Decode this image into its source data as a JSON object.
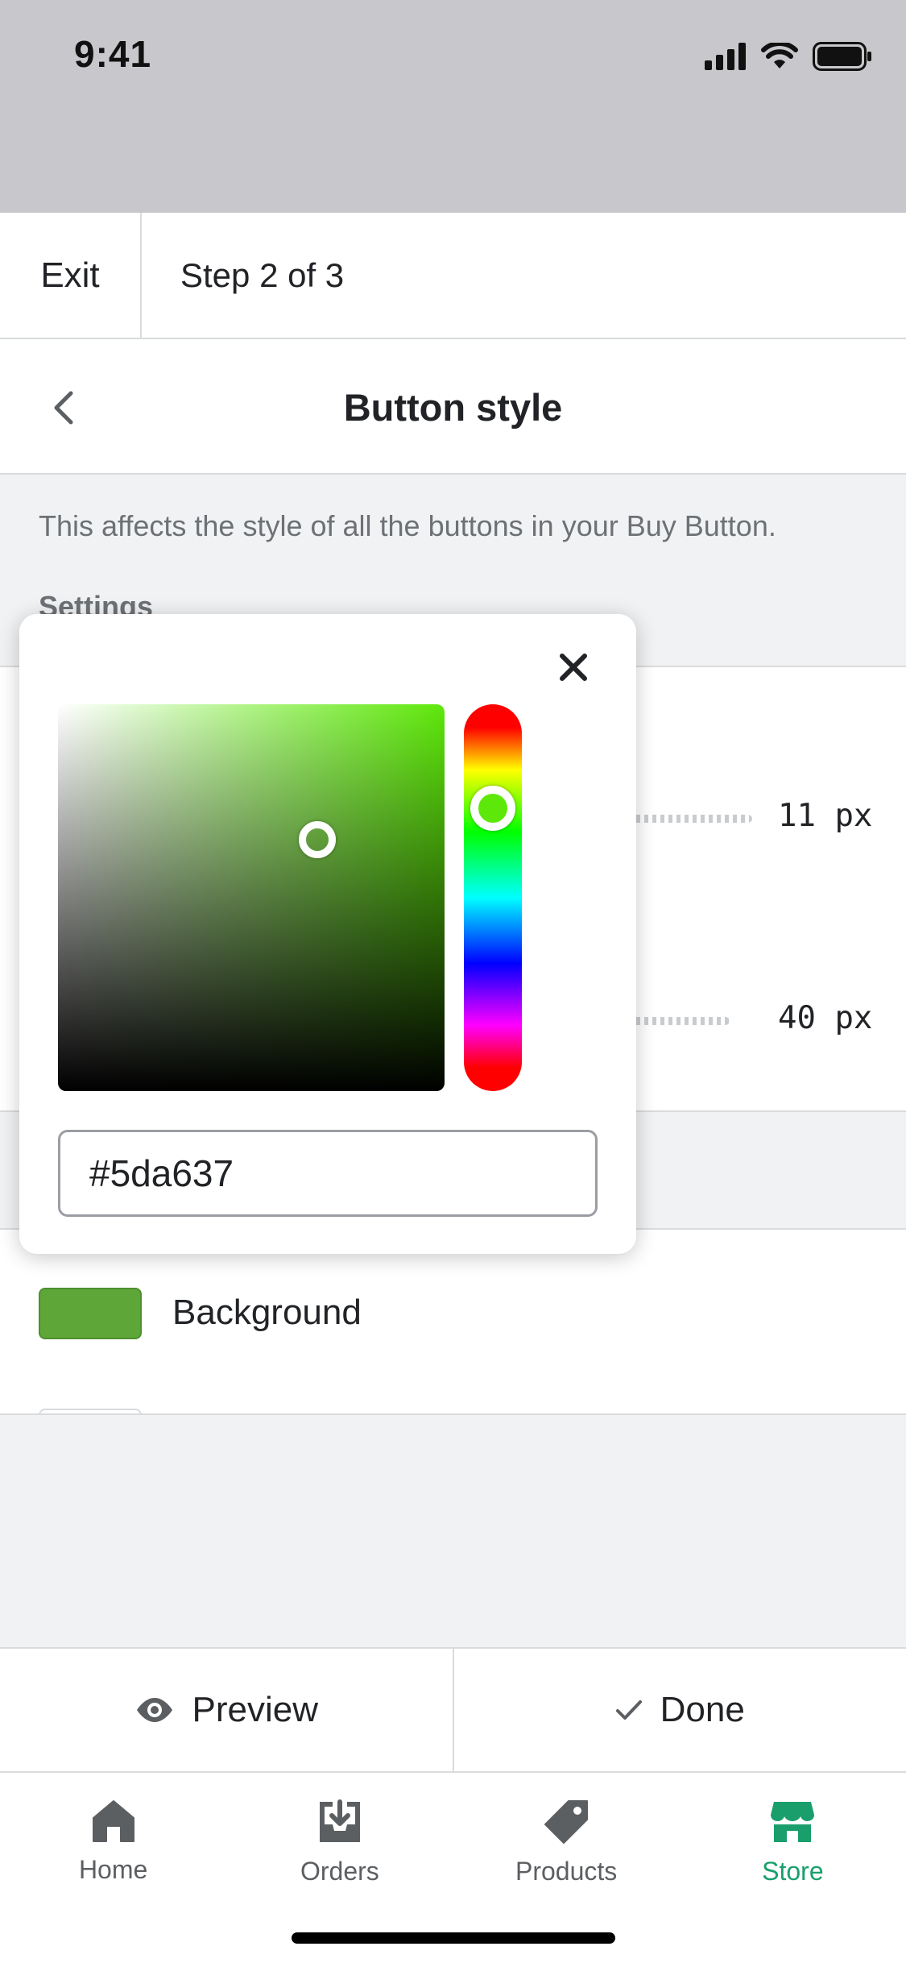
{
  "status_bar": {
    "time": "9:41"
  },
  "stepbar": {
    "exit_label": "Exit",
    "step_text": "Step 2 of 3"
  },
  "header": {
    "title": "Button style"
  },
  "intro": {
    "description": "This affects the style of all the buttons in your Buy Button.",
    "settings_label": "Settings"
  },
  "sliders": [
    {
      "value_text": "11 px"
    },
    {
      "value_text": "40 px"
    }
  ],
  "colors": {
    "background_label": "Background",
    "background_color": "#5da637"
  },
  "color_picker": {
    "hex_value": "#5da637",
    "hue_color": "#5ee80a",
    "saturation": 0.67,
    "brightness": 0.65,
    "hue_degrees": 97
  },
  "actions": {
    "preview_label": "Preview",
    "done_label": "Done"
  },
  "tabs": [
    {
      "label": "Home",
      "icon": "home-icon",
      "active": false
    },
    {
      "label": "Orders",
      "icon": "orders-icon",
      "active": false
    },
    {
      "label": "Products",
      "icon": "tag-icon",
      "active": false
    },
    {
      "label": "Store",
      "icon": "store-icon",
      "active": true
    }
  ],
  "theme": {
    "accent": "#1a9f6c",
    "text": "#212326",
    "muted": "#6d7175"
  }
}
